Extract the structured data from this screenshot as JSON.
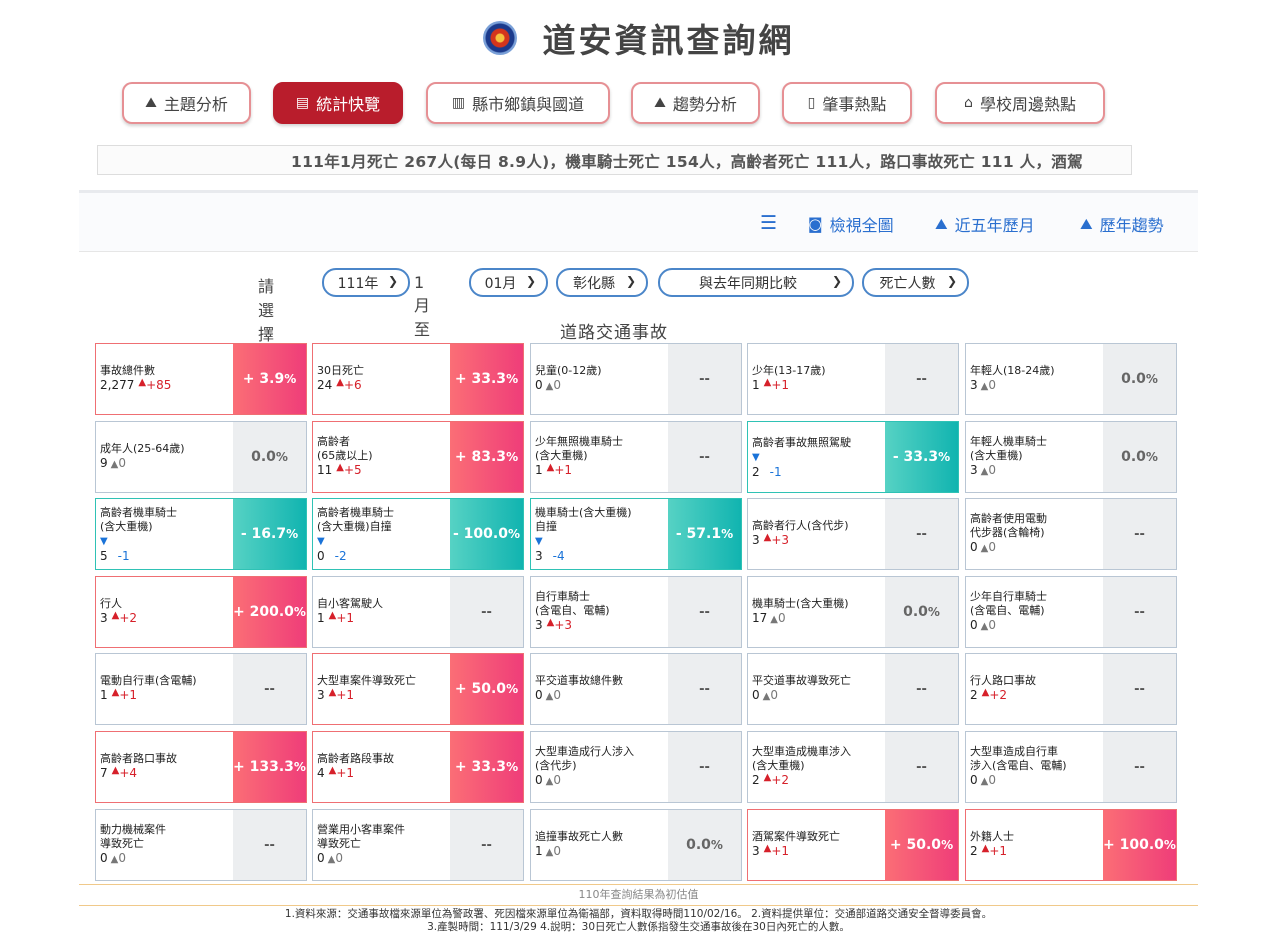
{
  "site": {
    "title": "道安資訊查詢網"
  },
  "nav": {
    "items": [
      {
        "label": "主題分析",
        "icon": "area-chart-icon"
      },
      {
        "label": "統計快覽",
        "icon": "newspaper-icon",
        "active": true
      },
      {
        "label": "縣市鄉鎮與國道",
        "icon": "bar-chart-icon"
      },
      {
        "label": "趨勢分析",
        "icon": "area-chart-icon"
      },
      {
        "label": "肇事熱點",
        "icon": "map-icon"
      },
      {
        "label": "學校周邊熱點",
        "icon": "school-icon"
      }
    ]
  },
  "ticker": {
    "text": "111年1月死亡 267人(每日 8.9人)，機車騎士死亡 154人，高齡者死亡 111人，路口事故死亡 111 人，酒駕"
  },
  "toolbar": {
    "view_all": "檢視全圖",
    "five_year": "近五年歷月",
    "history": "歷年趨勢"
  },
  "filters": {
    "prompt": "請選擇",
    "year": "111年",
    "from_label": "1月至",
    "month": "01月",
    "county": "彰化縣",
    "compare": "與去年同期比較",
    "metric": "死亡人數"
  },
  "section_title": "道路交通事故",
  "cards": [
    {
      "title": "事故總件數",
      "value": "2,277",
      "dir": "up",
      "delta": "+85",
      "pct": "+ 3.9",
      "pct_type": "up"
    },
    {
      "title": "30日死亡",
      "value": "24",
      "dir": "up",
      "delta": "+6",
      "pct": "+ 33.3",
      "pct_type": "up"
    },
    {
      "title": "兒童(0-12歲)",
      "value": "0",
      "dir": "zero",
      "delta": "0",
      "pct": "--",
      "pct_type": "none"
    },
    {
      "title": "少年(13-17歲)",
      "value": "1",
      "dir": "up",
      "delta": "+1",
      "pct": "--",
      "pct_type": "none"
    },
    {
      "title": "年輕人(18-24歲)",
      "value": "3",
      "dir": "zero",
      "delta": "0",
      "pct": "0.0",
      "pct_type": "zero"
    },
    {
      "title": "成年人(25-64歲)",
      "value": "9",
      "dir": "zero",
      "delta": "0",
      "pct": "0.0",
      "pct_type": "zero"
    },
    {
      "title": "高齡者\n(65歲以上)",
      "value": "11",
      "dir": "up",
      "delta": "+5",
      "pct": "+ 83.3",
      "pct_type": "up"
    },
    {
      "title": "少年無照機車騎士\n(含大重機)",
      "value": "1",
      "dir": "up",
      "delta": "+1",
      "pct": "--",
      "pct_type": "none"
    },
    {
      "title": "高齡者事故無照駕駛",
      "value": "2",
      "dir": "down",
      "delta": "-1",
      "pct": "- 33.3",
      "pct_type": "down"
    },
    {
      "title": "年輕人機車騎士\n(含大重機)",
      "value": "3",
      "dir": "zero",
      "delta": "0",
      "pct": "0.0",
      "pct_type": "zero"
    },
    {
      "title": "高齡者機車騎士\n(含大重機)",
      "value": "5",
      "dir": "down",
      "delta": "-1",
      "pct": "- 16.7",
      "pct_type": "down"
    },
    {
      "title": "高齡者機車騎士\n(含大重機)自撞",
      "value": "0",
      "dir": "down",
      "delta": "-2",
      "pct": "- 100.0",
      "pct_type": "down"
    },
    {
      "title": "機車騎士(含大重機)\n自撞",
      "value": "3",
      "dir": "down",
      "delta": "-4",
      "pct": "- 57.1",
      "pct_type": "down"
    },
    {
      "title": "高齡者行人(含代步)",
      "value": "3",
      "dir": "up",
      "delta": "+3",
      "pct": "--",
      "pct_type": "none"
    },
    {
      "title": "高齡者使用電動\n代步器(含輪椅)",
      "value": "0",
      "dir": "zero",
      "delta": "0",
      "pct": "--",
      "pct_type": "none"
    },
    {
      "title": "行人",
      "value": "3",
      "dir": "up",
      "delta": "+2",
      "pct": "+ 200.0",
      "pct_type": "up"
    },
    {
      "title": "自小客駕駛人",
      "value": "1",
      "dir": "up",
      "delta": "+1",
      "pct": "--",
      "pct_type": "none"
    },
    {
      "title": "自行車騎士\n(含電自、電輔)",
      "value": "3",
      "dir": "up",
      "delta": "+3",
      "pct": "--",
      "pct_type": "none"
    },
    {
      "title": "機車騎士(含大重機)",
      "value": "17",
      "dir": "zero",
      "delta": "0",
      "pct": "0.0",
      "pct_type": "zero"
    },
    {
      "title": "少年自行車騎士\n(含電自、電輔)",
      "value": "0",
      "dir": "zero",
      "delta": "0",
      "pct": "--",
      "pct_type": "none"
    },
    {
      "title": "電動自行車(含電輔)",
      "value": "1",
      "dir": "up",
      "delta": "+1",
      "pct": "--",
      "pct_type": "none"
    },
    {
      "title": "大型車案件導致死亡",
      "value": "3",
      "dir": "up",
      "delta": "+1",
      "pct": "+ 50.0",
      "pct_type": "up"
    },
    {
      "title": "平交道事故總件數",
      "value": "0",
      "dir": "zero",
      "delta": "0",
      "pct": "--",
      "pct_type": "none"
    },
    {
      "title": "平交道事故導致死亡",
      "value": "0",
      "dir": "zero",
      "delta": "0",
      "pct": "--",
      "pct_type": "none"
    },
    {
      "title": "行人路口事故",
      "value": "2",
      "dir": "up",
      "delta": "+2",
      "pct": "--",
      "pct_type": "none"
    },
    {
      "title": "高齡者路口事故",
      "value": "7",
      "dir": "up",
      "delta": "+4",
      "pct": "+ 133.3",
      "pct_type": "up"
    },
    {
      "title": "高齡者路段事故",
      "value": "4",
      "dir": "up",
      "delta": "+1",
      "pct": "+ 33.3",
      "pct_type": "up"
    },
    {
      "title": "大型車造成行人涉入\n(含代步)",
      "value": "0",
      "dir": "zero",
      "delta": "0",
      "pct": "--",
      "pct_type": "none"
    },
    {
      "title": "大型車造成機車涉入\n(含大重機)",
      "value": "2",
      "dir": "up",
      "delta": "+2",
      "pct": "--",
      "pct_type": "none"
    },
    {
      "title": "大型車造成自行車\n涉入(含電自、電輔)",
      "value": "0",
      "dir": "zero",
      "delta": "0",
      "pct": "--",
      "pct_type": "none"
    },
    {
      "title": "動力機械案件\n導致死亡",
      "value": "0",
      "dir": "zero",
      "delta": "0",
      "pct": "--",
      "pct_type": "none"
    },
    {
      "title": "營業用小客車案件\n導致死亡",
      "value": "0",
      "dir": "zero",
      "delta": "0",
      "pct": "--",
      "pct_type": "none"
    },
    {
      "title": "追撞事故死亡人數",
      "value": "1",
      "dir": "zero",
      "delta": "0",
      "pct": "0.0",
      "pct_type": "zero"
    },
    {
      "title": "酒駕案件導致死亡",
      "value": "3",
      "dir": "up",
      "delta": "+1",
      "pct": "+ 50.0",
      "pct_type": "up"
    },
    {
      "title": "外籍人士",
      "value": "2",
      "dir": "up",
      "delta": "+1",
      "pct": "+ 100.0",
      "pct_type": "up"
    }
  ],
  "footnote": "110年查詢結果為初估值",
  "source": {
    "line1": "1.資料來源：交通事故檔來源單位為警政署、死因檔來源單位為衛福部，資料取得時間110/02/16。 2.資料提供單位：交通部道路交通安全督導委員會。",
    "line2": "3.產製時間：111/3/29 4.說明：30日死亡人數係指發生交通事故後在30日內死亡的人數。"
  }
}
